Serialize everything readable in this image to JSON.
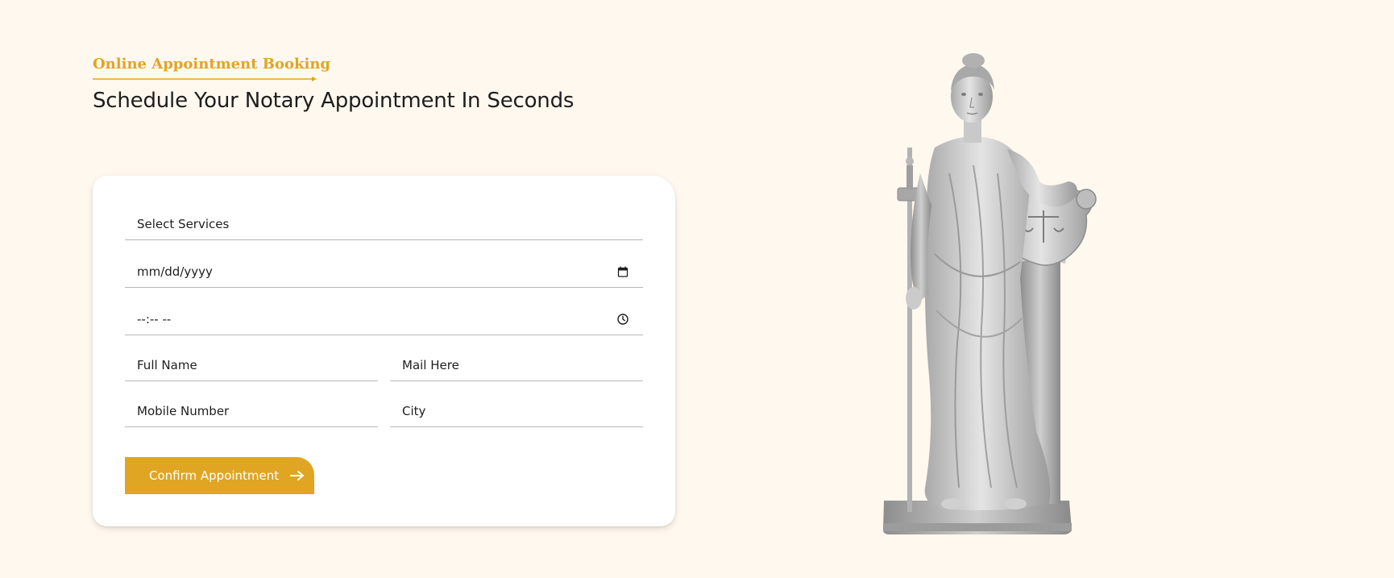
{
  "header": {
    "eyebrow": "Online Appointment Booking",
    "title": "Schedule Your Notary Appointment In Seconds"
  },
  "form": {
    "service_select": "Select Services",
    "date_placeholder": "mm/dd/yyyy",
    "time_placeholder": "--:-- --",
    "full_name_placeholder": "Full Name",
    "mail_placeholder": "Mail Here",
    "mobile_placeholder": "Mobile Number",
    "city_placeholder": "City",
    "submit_label": "Confirm Appointment"
  },
  "icons": {
    "date": "calendar-icon",
    "time": "clock-icon",
    "submit": "arrow-right-icon",
    "eyebrow_underline": "arrow-line-icon"
  },
  "colors": {
    "accent": "#e0a523",
    "background": "#fff8ee",
    "card": "#ffffff",
    "text": "#1e1e1e"
  },
  "image": {
    "subject": "Lady Justice statue with sword and scales shield"
  }
}
